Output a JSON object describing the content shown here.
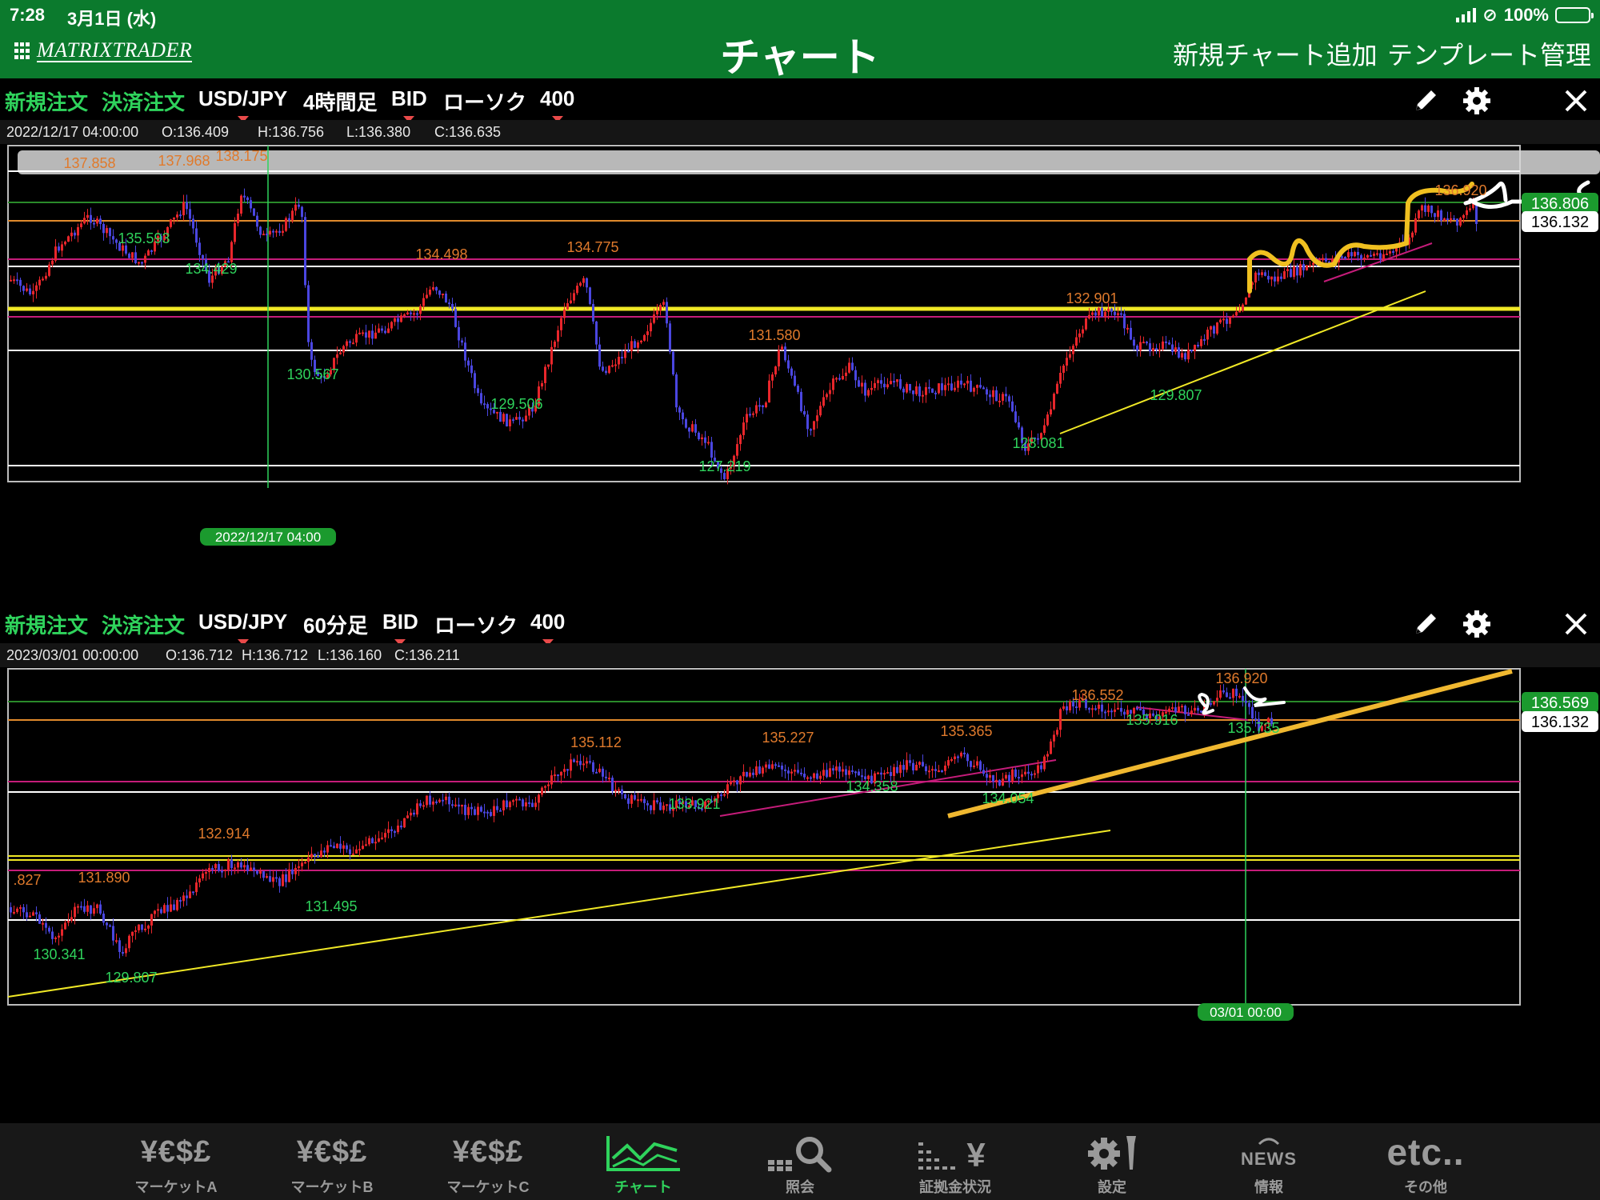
{
  "status_bar": {
    "time": "7:28",
    "date": "3月1日 (水)",
    "battery": "100%"
  },
  "header": {
    "logo": "MATRIXTRADER",
    "title": "チャート",
    "add_chart": "新規チャート追加",
    "template": "テンプレート管理"
  },
  "charts": [
    {
      "toolbar": {
        "new_order": "新規注文",
        "close_order": "決済注文",
        "pair": "USD/JPY",
        "timeframe": "4時間足",
        "price_type": "BID",
        "chart_type": "ローソク",
        "count": "400"
      },
      "ohlc": {
        "datetime": "2022/12/17 04:00:00",
        "open": "O:136.409",
        "high": "H:136.756",
        "low": "L:136.380",
        "close": "C:136.635"
      },
      "price_tags": {
        "green": "136.806",
        "white": "136.132"
      },
      "cursor_label": "2022/12/17 04:00",
      "high_labels": [
        "137.858",
        "137.968",
        "138.175",
        "134.498",
        "134.775",
        "131.580",
        "132.901",
        "136.920"
      ],
      "low_labels": [
        "135.593",
        "134.429",
        "130.567",
        "129.506",
        "127.219",
        "128.081",
        "129.807"
      ]
    },
    {
      "toolbar": {
        "new_order": "新規注文",
        "close_order": "決済注文",
        "pair": "USD/JPY",
        "timeframe": "60分足",
        "price_type": "BID",
        "chart_type": "ローソク",
        "count": "400"
      },
      "ohlc": {
        "datetime": "2023/03/01 00:00:00",
        "open": "O:136.712",
        "high": "H:136.712",
        "low": "L:136.160",
        "close": "C:136.211"
      },
      "price_tags": {
        "green": "136.569",
        "white": "136.132"
      },
      "cursor_label": "03/01 00:00",
      "high_labels": [
        ".827",
        "131.890",
        "132.914",
        "135.112",
        "135.227",
        "135.365",
        "136.552",
        "136.920"
      ],
      "low_labels": [
        "130.341",
        "129.807",
        "131.495",
        "133.921",
        "134.358",
        "134.054",
        "135.916",
        "135.735"
      ]
    }
  ],
  "colors": {
    "header_bg": "#0b7a2d",
    "up": "#e8262b",
    "down": "#4a46e0",
    "hi_label": "#e07a2c",
    "lo_label": "#2fd35c"
  },
  "tabs": [
    {
      "icon": "¥€$£",
      "label": "マーケットA"
    },
    {
      "icon": "¥€$£",
      "label": "マーケットB"
    },
    {
      "icon": "¥€$£",
      "label": "マーケットC"
    },
    {
      "icon": "chart-icon",
      "label": "チャート"
    },
    {
      "icon": "search-icon",
      "label": "照会"
    },
    {
      "icon": "margin-icon",
      "label": "証拠金状況"
    },
    {
      "icon": "settings-icon",
      "label": "設定"
    },
    {
      "icon": "NEWS",
      "label": "情報"
    },
    {
      "icon": "etc..",
      "label": "その他"
    }
  ]
}
